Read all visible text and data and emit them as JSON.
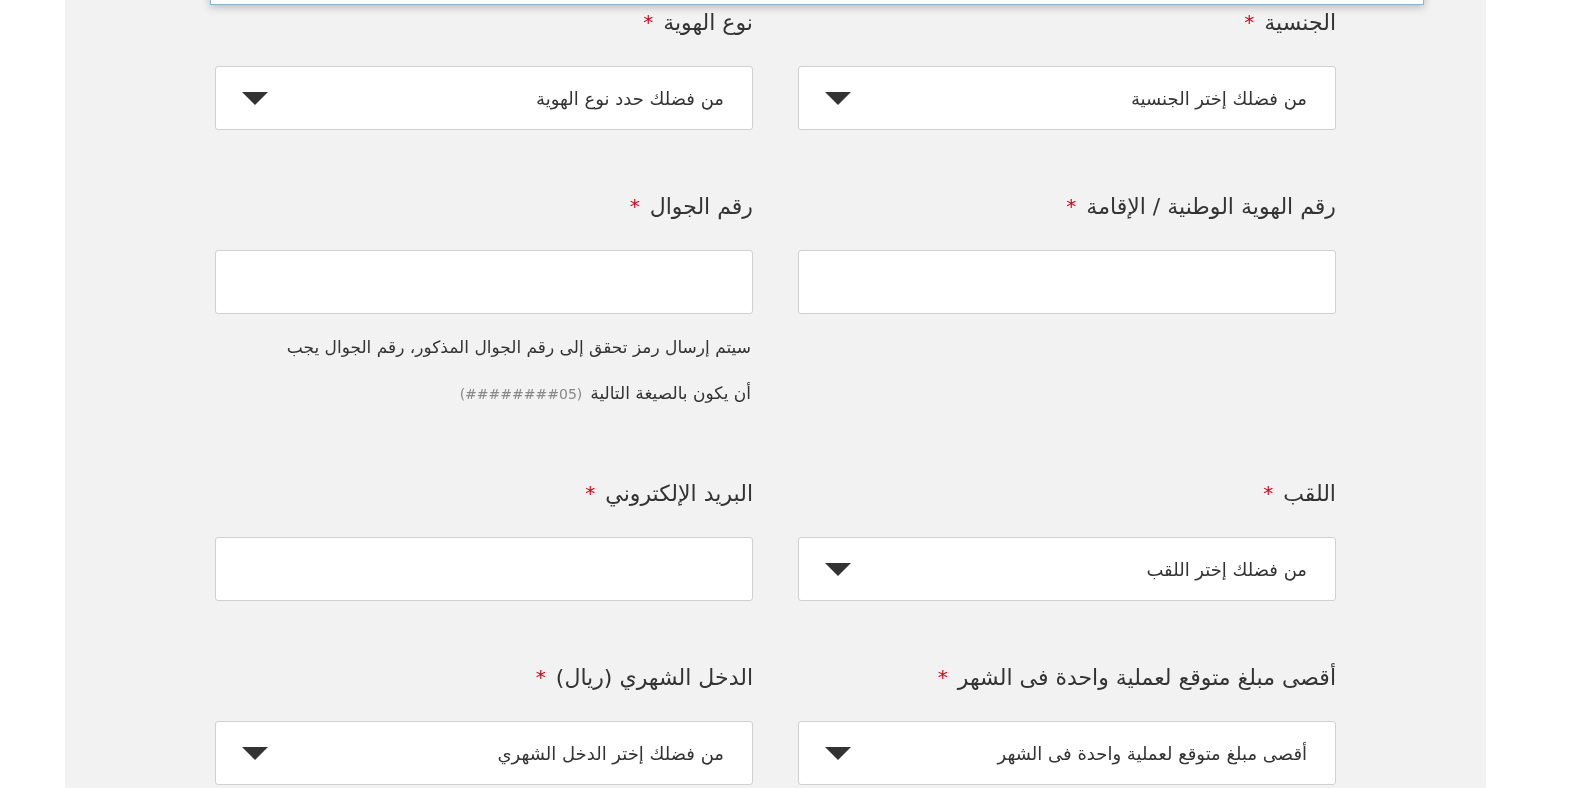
{
  "form": {
    "rows": [
      {
        "fields": [
          {
            "kind": "select",
            "label": "الجنسية",
            "required_mark": "*",
            "placeholder": "من فضلك إختر الجنسية"
          },
          {
            "kind": "select",
            "label": "نوع الهوية",
            "required_mark": "*",
            "placeholder": "من فضلك حدد نوع الهوية"
          }
        ]
      },
      {
        "fields": [
          {
            "kind": "input",
            "label": "رقم الهوية الوطنية / الإقامة",
            "required_mark": "*"
          },
          {
            "kind": "input",
            "label": "رقم الجوال",
            "required_mark": "*",
            "hint_lines": [
              "سيتم إرسال رمز تحقق إلى رقم الجوال المذكور، رقم الجوال يجب",
              "أن يكون بالصيغة التالية"
            ],
            "hint_format": "(05########)"
          }
        ]
      },
      {
        "fields": [
          {
            "kind": "select",
            "label": "اللقب",
            "required_mark": "*",
            "placeholder": "من فضلك إختر اللقب"
          },
          {
            "kind": "input",
            "label": "البريد الإلكتروني",
            "required_mark": "*"
          }
        ]
      },
      {
        "fields": [
          {
            "kind": "select",
            "label": "أقصى مبلغ متوقع لعملية واحدة فى الشهر",
            "required_mark": "*",
            "placeholder": "أقصى مبلغ متوقع لعملية واحدة فى الشهر"
          },
          {
            "kind": "select",
            "label": "الدخل الشهري (ريال)",
            "required_mark": "*",
            "placeholder": "من فضلك إختر الدخل الشهري"
          }
        ]
      }
    ]
  }
}
